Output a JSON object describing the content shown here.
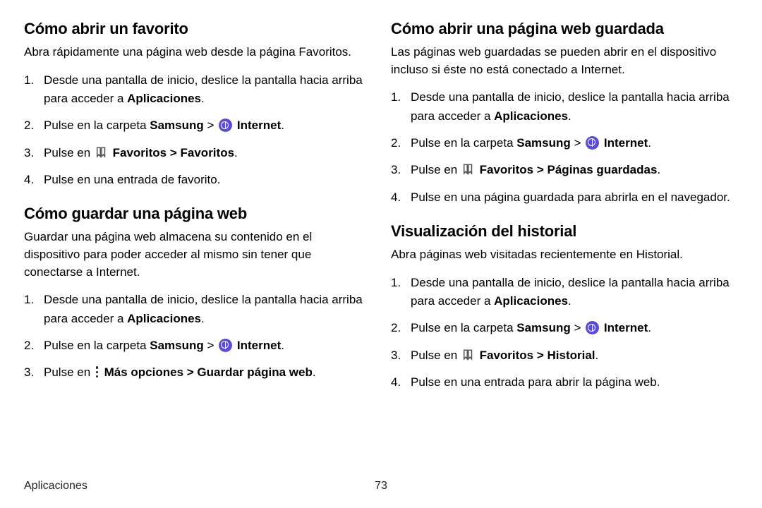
{
  "footer": {
    "section": "Aplicaciones",
    "page": "73"
  },
  "left": {
    "s1": {
      "heading": "Cómo abrir un favorito",
      "intro": "Abra rápidamente una página web desde la página Favoritos.",
      "steps": [
        {
          "pre": "Desde una pantalla de inicio, deslice la pantalla hacia arriba para acceder a ",
          "bold1": "Aplicaciones",
          "post": "."
        },
        {
          "pre": "Pulse en la carpeta ",
          "bold1": "Samsung",
          "sep1": " > ",
          "icon": "internet",
          "bold2": " Internet",
          "post": "."
        },
        {
          "pre": "Pulse en ",
          "icon": "fav",
          "bold1": " Favoritos",
          "sep1": " > ",
          "bold2": "Favoritos",
          "post": "."
        },
        {
          "pre": "Pulse en una entrada de favorito."
        }
      ]
    },
    "s2": {
      "heading": "Cómo guardar una página web",
      "intro": "Guardar una página web almacena su contenido en el dispositivo para poder acceder al mismo sin tener que conectarse a Internet.",
      "steps": [
        {
          "pre": "Desde una pantalla de inicio, deslice la pantalla hacia arriba para acceder a ",
          "bold1": "Aplicaciones",
          "post": "."
        },
        {
          "pre": "Pulse en la carpeta ",
          "bold1": "Samsung",
          "sep1": " > ",
          "icon": "internet",
          "bold2": " Internet",
          "post": "."
        },
        {
          "pre": "Pulse en ",
          "icon": "more",
          "bold1": " Más opciones",
          "sep1": " > ",
          "bold2": "Guardar página web",
          "post": "."
        }
      ]
    }
  },
  "right": {
    "s1": {
      "heading": "Cómo abrir una página web guardada",
      "intro": "Las páginas web guardadas se pueden abrir en el dispositivo incluso si éste no está conectado a Internet.",
      "steps": [
        {
          "pre": "Desde una pantalla de inicio, deslice la pantalla hacia arriba para acceder a ",
          "bold1": "Aplicaciones",
          "post": "."
        },
        {
          "pre": "Pulse en la carpeta ",
          "bold1": "Samsung",
          "sep1": " > ",
          "icon": "internet",
          "bold2": " Internet",
          "post": "."
        },
        {
          "pre": "Pulse en ",
          "icon": "fav",
          "bold1": " Favoritos",
          "sep1": " > ",
          "bold2": "Páginas guardadas",
          "post": "."
        },
        {
          "pre": "Pulse en una página guardada para abrirla en el navegador."
        }
      ]
    },
    "s2": {
      "heading": "Visualización del historial",
      "intro": "Abra páginas web visitadas recientemente en Historial.",
      "steps": [
        {
          "pre": "Desde una pantalla de inicio, deslice la pantalla hacia arriba para acceder a ",
          "bold1": "Aplicaciones",
          "post": "."
        },
        {
          "pre": "Pulse en la carpeta ",
          "bold1": "Samsung",
          "sep1": " > ",
          "icon": "internet",
          "bold2": " Internet",
          "post": "."
        },
        {
          "pre": "Pulse en ",
          "icon": "fav",
          "bold1": " Favoritos",
          "sep1": " > ",
          "bold2": "Historial",
          "post": "."
        },
        {
          "pre": "Pulse en una entrada para abrir la página web."
        }
      ]
    }
  }
}
